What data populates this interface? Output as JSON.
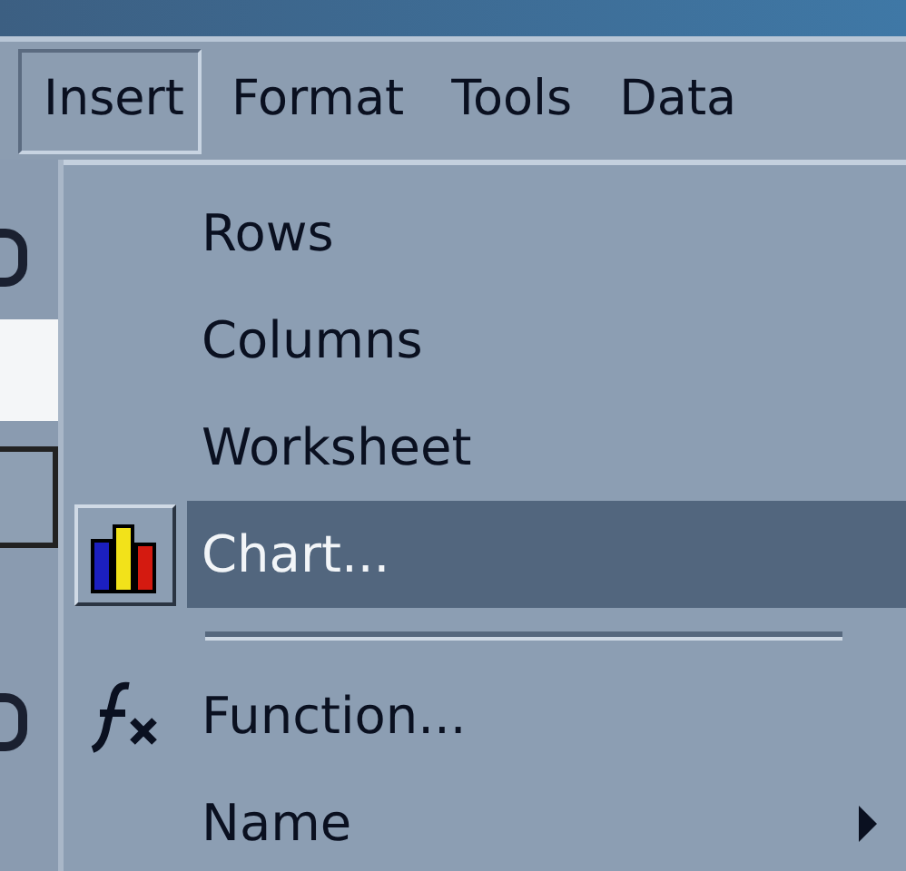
{
  "menubar": [
    {
      "label": "Insert",
      "selected": true
    },
    {
      "label": "Format",
      "selected": false
    },
    {
      "label": "Tools",
      "selected": false
    },
    {
      "label": "Data",
      "selected": false
    }
  ],
  "menu": [
    {
      "kind": "plain",
      "label": "Rows",
      "selected": false
    },
    {
      "kind": "plain",
      "label": "Columns",
      "selected": false
    },
    {
      "kind": "plain",
      "label": "Worksheet",
      "selected": false
    },
    {
      "kind": "chart",
      "label": "Chart...",
      "selected": true
    },
    {
      "kind": "separator"
    },
    {
      "kind": "function",
      "label": "Function...",
      "selected": false
    },
    {
      "kind": "submenu",
      "label": "Name",
      "selected": false
    }
  ]
}
